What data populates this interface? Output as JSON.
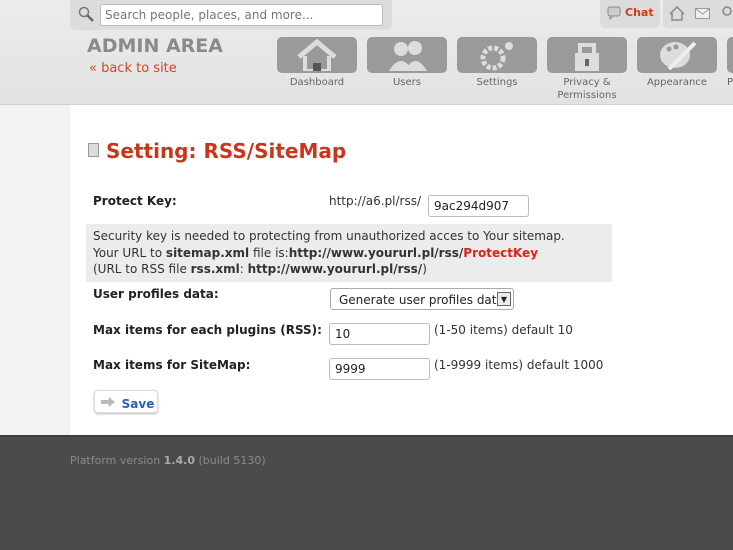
{
  "search": {
    "placeholder": "Search people, places, and more..."
  },
  "topbar": {
    "chat": "Chat"
  },
  "header": {
    "title": "ADMIN AREA",
    "back_link": "« back to site"
  },
  "nav": [
    {
      "label": "Dashboard",
      "icon": "home-icon"
    },
    {
      "label": "Users",
      "icon": "users-icon"
    },
    {
      "label": "Settings",
      "icon": "gears-icon"
    },
    {
      "label": "Privacy & Permissions",
      "icon": "lock-icon"
    },
    {
      "label": "Appearance",
      "icon": "palette-icon"
    },
    {
      "label": "P",
      "icon": "plugin-icon"
    }
  ],
  "page": {
    "title": "Setting: RSS/SiteMap"
  },
  "form": {
    "protect_key_label": "Protect Key:",
    "protect_key_prefix": "http://a6.pl/rss/",
    "protect_key_value": "9ac294d907",
    "info": {
      "line1": "Security key is needed to protecting from unauthorized acces to Your sitemap.",
      "l2a": "Your URL to ",
      "l2b": "sitemap.xml",
      "l2c": " file is:",
      "l2d": "http://www.yoururl.pl/rss/",
      "l2e": "ProtectKey",
      "l3a": "(URL to RSS file ",
      "l3b": "rss.xml",
      "l3c": ": ",
      "l3d": "http://www.yoururl.pl/rss/",
      "l3e": ")"
    },
    "user_profiles_label": "User profiles data:",
    "user_profiles_value": "Generate user profiles data",
    "max_rss_label": "Max items for each plugins (RSS):",
    "max_rss_value": "10",
    "max_rss_hint": "(1-50 items) default 10",
    "max_sitemap_label": "Max items for SiteMap:",
    "max_sitemap_value": "9999",
    "max_sitemap_hint": "(1-9999 items) default 1000",
    "save": "Save"
  },
  "footer": {
    "prefix": "Platform version ",
    "version": "1.4.0",
    "build": " (build 5130)"
  },
  "colors": {
    "accent": "#c8371c",
    "link": "#2b5db8",
    "footer": "#4b4b4b"
  }
}
